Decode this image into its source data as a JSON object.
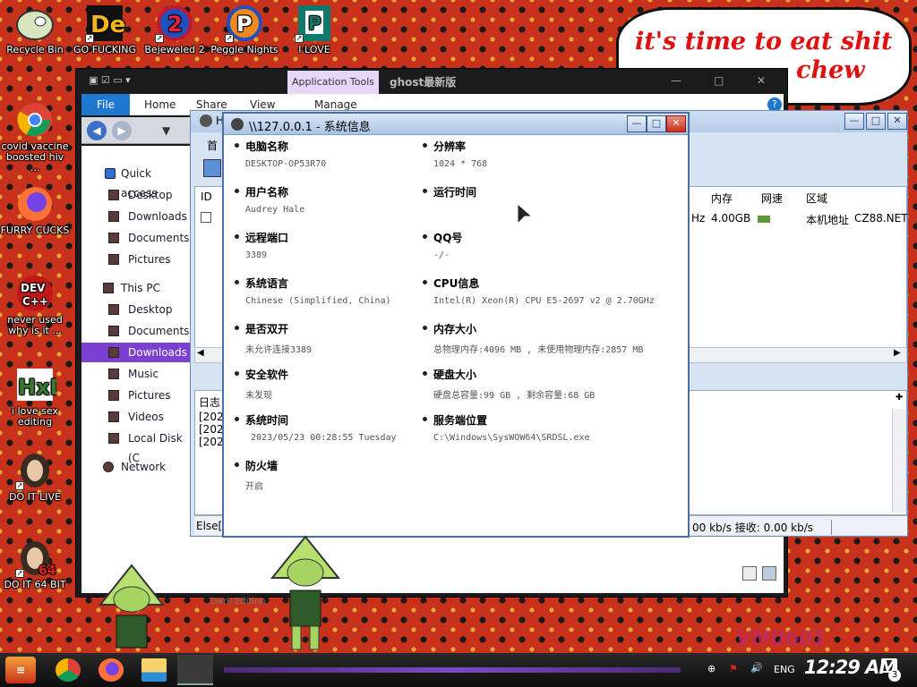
{
  "desktop": {
    "icons": [
      {
        "label": "Recycle Bin",
        "icon": "recycle-bin-icon"
      },
      {
        "label": "GO FUCKING",
        "icon": "de-app-icon"
      },
      {
        "label": "Bejeweled 2",
        "icon": "bejeweled-icon"
      },
      {
        "label": "Peggle Nights",
        "icon": "peggle-icon"
      },
      {
        "label": "I LOVE",
        "icon": "publisher-icon"
      },
      {
        "label": "covid vaccine boosted hiv ...",
        "icon": "chrome-icon"
      },
      {
        "label": "FURRY CUCKS",
        "icon": "firefox-icon"
      },
      {
        "label": "never used why is it ...",
        "icon": "devcpp-icon"
      },
      {
        "label": "i love sex editing",
        "icon": "hxd-icon"
      },
      {
        "label": "DO IT LIVE",
        "icon": "portrait-icon"
      },
      {
        "label": "DO IT 64 BIT",
        "icon": "portrait-64-icon"
      }
    ],
    "bubble_line1": "it's time to eat shit",
    "bubble_line2": "chew",
    "watermark": "VM0b01"
  },
  "explorer": {
    "contextual_tab": "Application Tools",
    "window_title": "ghost最新版",
    "ribbon_tabs": [
      "File",
      "Home",
      "Share",
      "View",
      "Manage"
    ],
    "nav": [
      "Quick access",
      "Desktop",
      "Downloads",
      "Documents",
      "Pictures",
      "This PC",
      "Desktop",
      "Documents",
      "Downloads",
      "Music",
      "Pictures",
      "Videos",
      "Local Disk (C",
      "Network"
    ],
    "bottom_label": "Dark Edition"
  },
  "console": {
    "title": "H",
    "toolbar_text": "首",
    "columns": {
      "id": "ID",
      "mem": "内存",
      "net": "网速",
      "region": "区域"
    },
    "row": {
      "cpu_tail": "Hz",
      "mem": "4.00GB",
      "region": "本机地址",
      "host": "CZ88.NET"
    },
    "log_label": "日志",
    "log_lines": [
      "[2023",
      "[2023",
      "[2023"
    ],
    "status_left": "Else[",
    "status_right": "00 kb/s 接收: 0.00 kb/s"
  },
  "sysinfo": {
    "title": "\\\\127.0.0.1 - 系统信息",
    "fields": [
      {
        "label": "电脑名称",
        "value": "DESKTOP-OP53R70"
      },
      {
        "label": "分辨率",
        "value": "1024 * 768"
      },
      {
        "label": "用户名称",
        "value": "Audrey Hale"
      },
      {
        "label": "运行时间",
        "value": ""
      },
      {
        "label": "远程端口",
        "value": "3389"
      },
      {
        "label": "QQ号",
        "value": "-/-"
      },
      {
        "label": "系统语言",
        "value": "Chinese (Simplified, China)"
      },
      {
        "label": "CPU信息",
        "value": "Intel(R) Xeon(R) CPU E5-2697 v2 @ 2.70GHz"
      },
      {
        "label": "是否双开",
        "value": "未允许连接3389"
      },
      {
        "label": "内存大小",
        "value": "总物理内存:4096 MB , 未使用物理内存:2857 MB"
      },
      {
        "label": "安全软件",
        "value": "未发现"
      },
      {
        "label": "硬盘大小",
        "value": "硬盘总容量:99 GB , 剩余容量:68 GB"
      },
      {
        "label": "系统时间",
        "value": " 2023/05/23 00:28:55 Tuesday"
      },
      {
        "label": "服务端位置",
        "value": "C:\\Windows\\SysWOW64\\SRDSL.exe"
      },
      {
        "label": "防火墙",
        "value": "开启"
      }
    ]
  },
  "taskbar": {
    "lang": "ENG",
    "time": "12:29 AM",
    "notification_count": "3"
  }
}
